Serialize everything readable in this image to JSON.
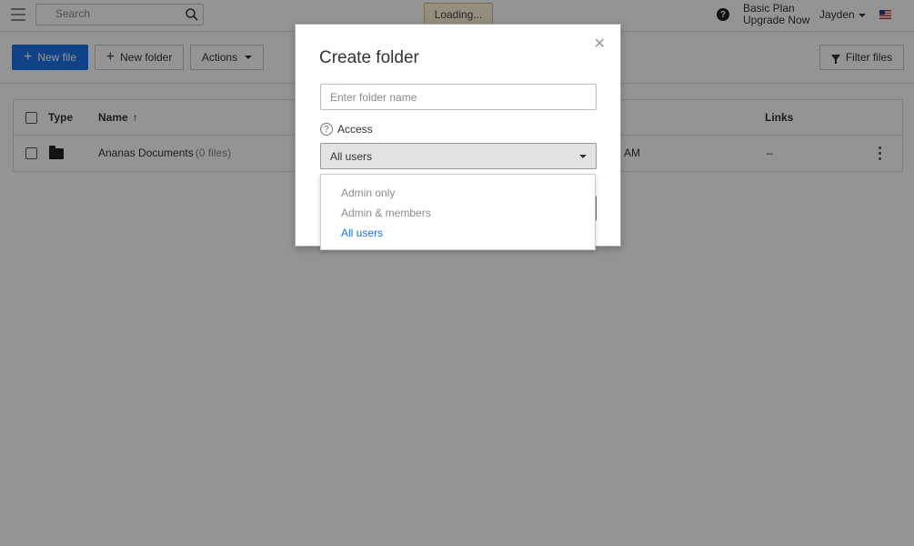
{
  "topbar": {
    "search_placeholder": "Search",
    "loading_text": "Loading...",
    "plan_name": "Basic Plan",
    "upgrade_label": "Upgrade Now",
    "user_name": "Jayden",
    "help_icon": "question-circle-icon",
    "flag_icon": "us-flag-icon"
  },
  "toolbar": {
    "new_file_label": "New file",
    "new_folder_label": "New folder",
    "actions_label": "Actions",
    "filter_label": "Filter files"
  },
  "table": {
    "columns": {
      "type": "Type",
      "name": "Name",
      "modified_partial": "AM",
      "links": "Links"
    },
    "rows": [
      {
        "name": "Ananas Documents",
        "count": "(0 files)",
        "modified_partial": "AM",
        "links": "–"
      }
    ]
  },
  "modal": {
    "title": "Create folder",
    "name_placeholder": "Enter folder name",
    "access_label": "Access",
    "access_selected": "All users",
    "access_options": [
      "Admin only",
      "Admin & members",
      "All users"
    ]
  },
  "colors": {
    "primary": "#1a73e8",
    "overlay": "rgba(0,0,0,0.42)"
  }
}
